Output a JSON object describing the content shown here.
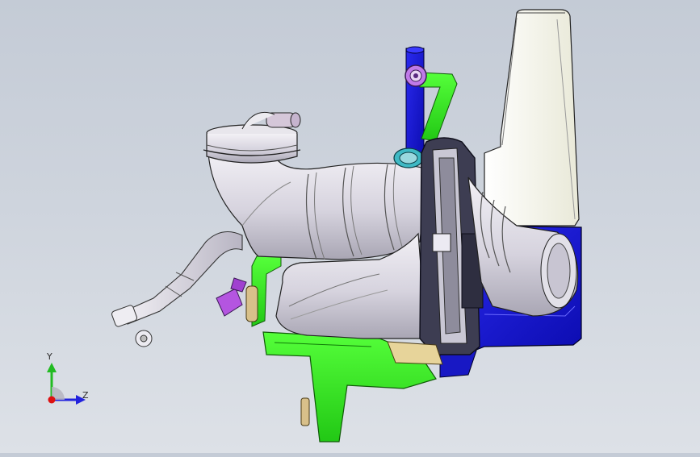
{
  "viewport": {
    "background_top": "#c4cbd6",
    "background_bottom": "#dde1e7",
    "model": {
      "colors": {
        "body": "#e6e4ea",
        "body_shade": "#a9a6b4",
        "green": "#33ee22",
        "blue": "#1a1ad8",
        "tank": "#f7f7ec",
        "purple": "#b455e0",
        "teal": "#38b2bd",
        "tan": "#cfb77a",
        "dark": "#343447"
      }
    }
  },
  "triad": {
    "y_label": "Y",
    "z_label": "Z",
    "y_color": "#22bb22",
    "z_color": "#2222dd",
    "x_color": "#dd1111"
  }
}
